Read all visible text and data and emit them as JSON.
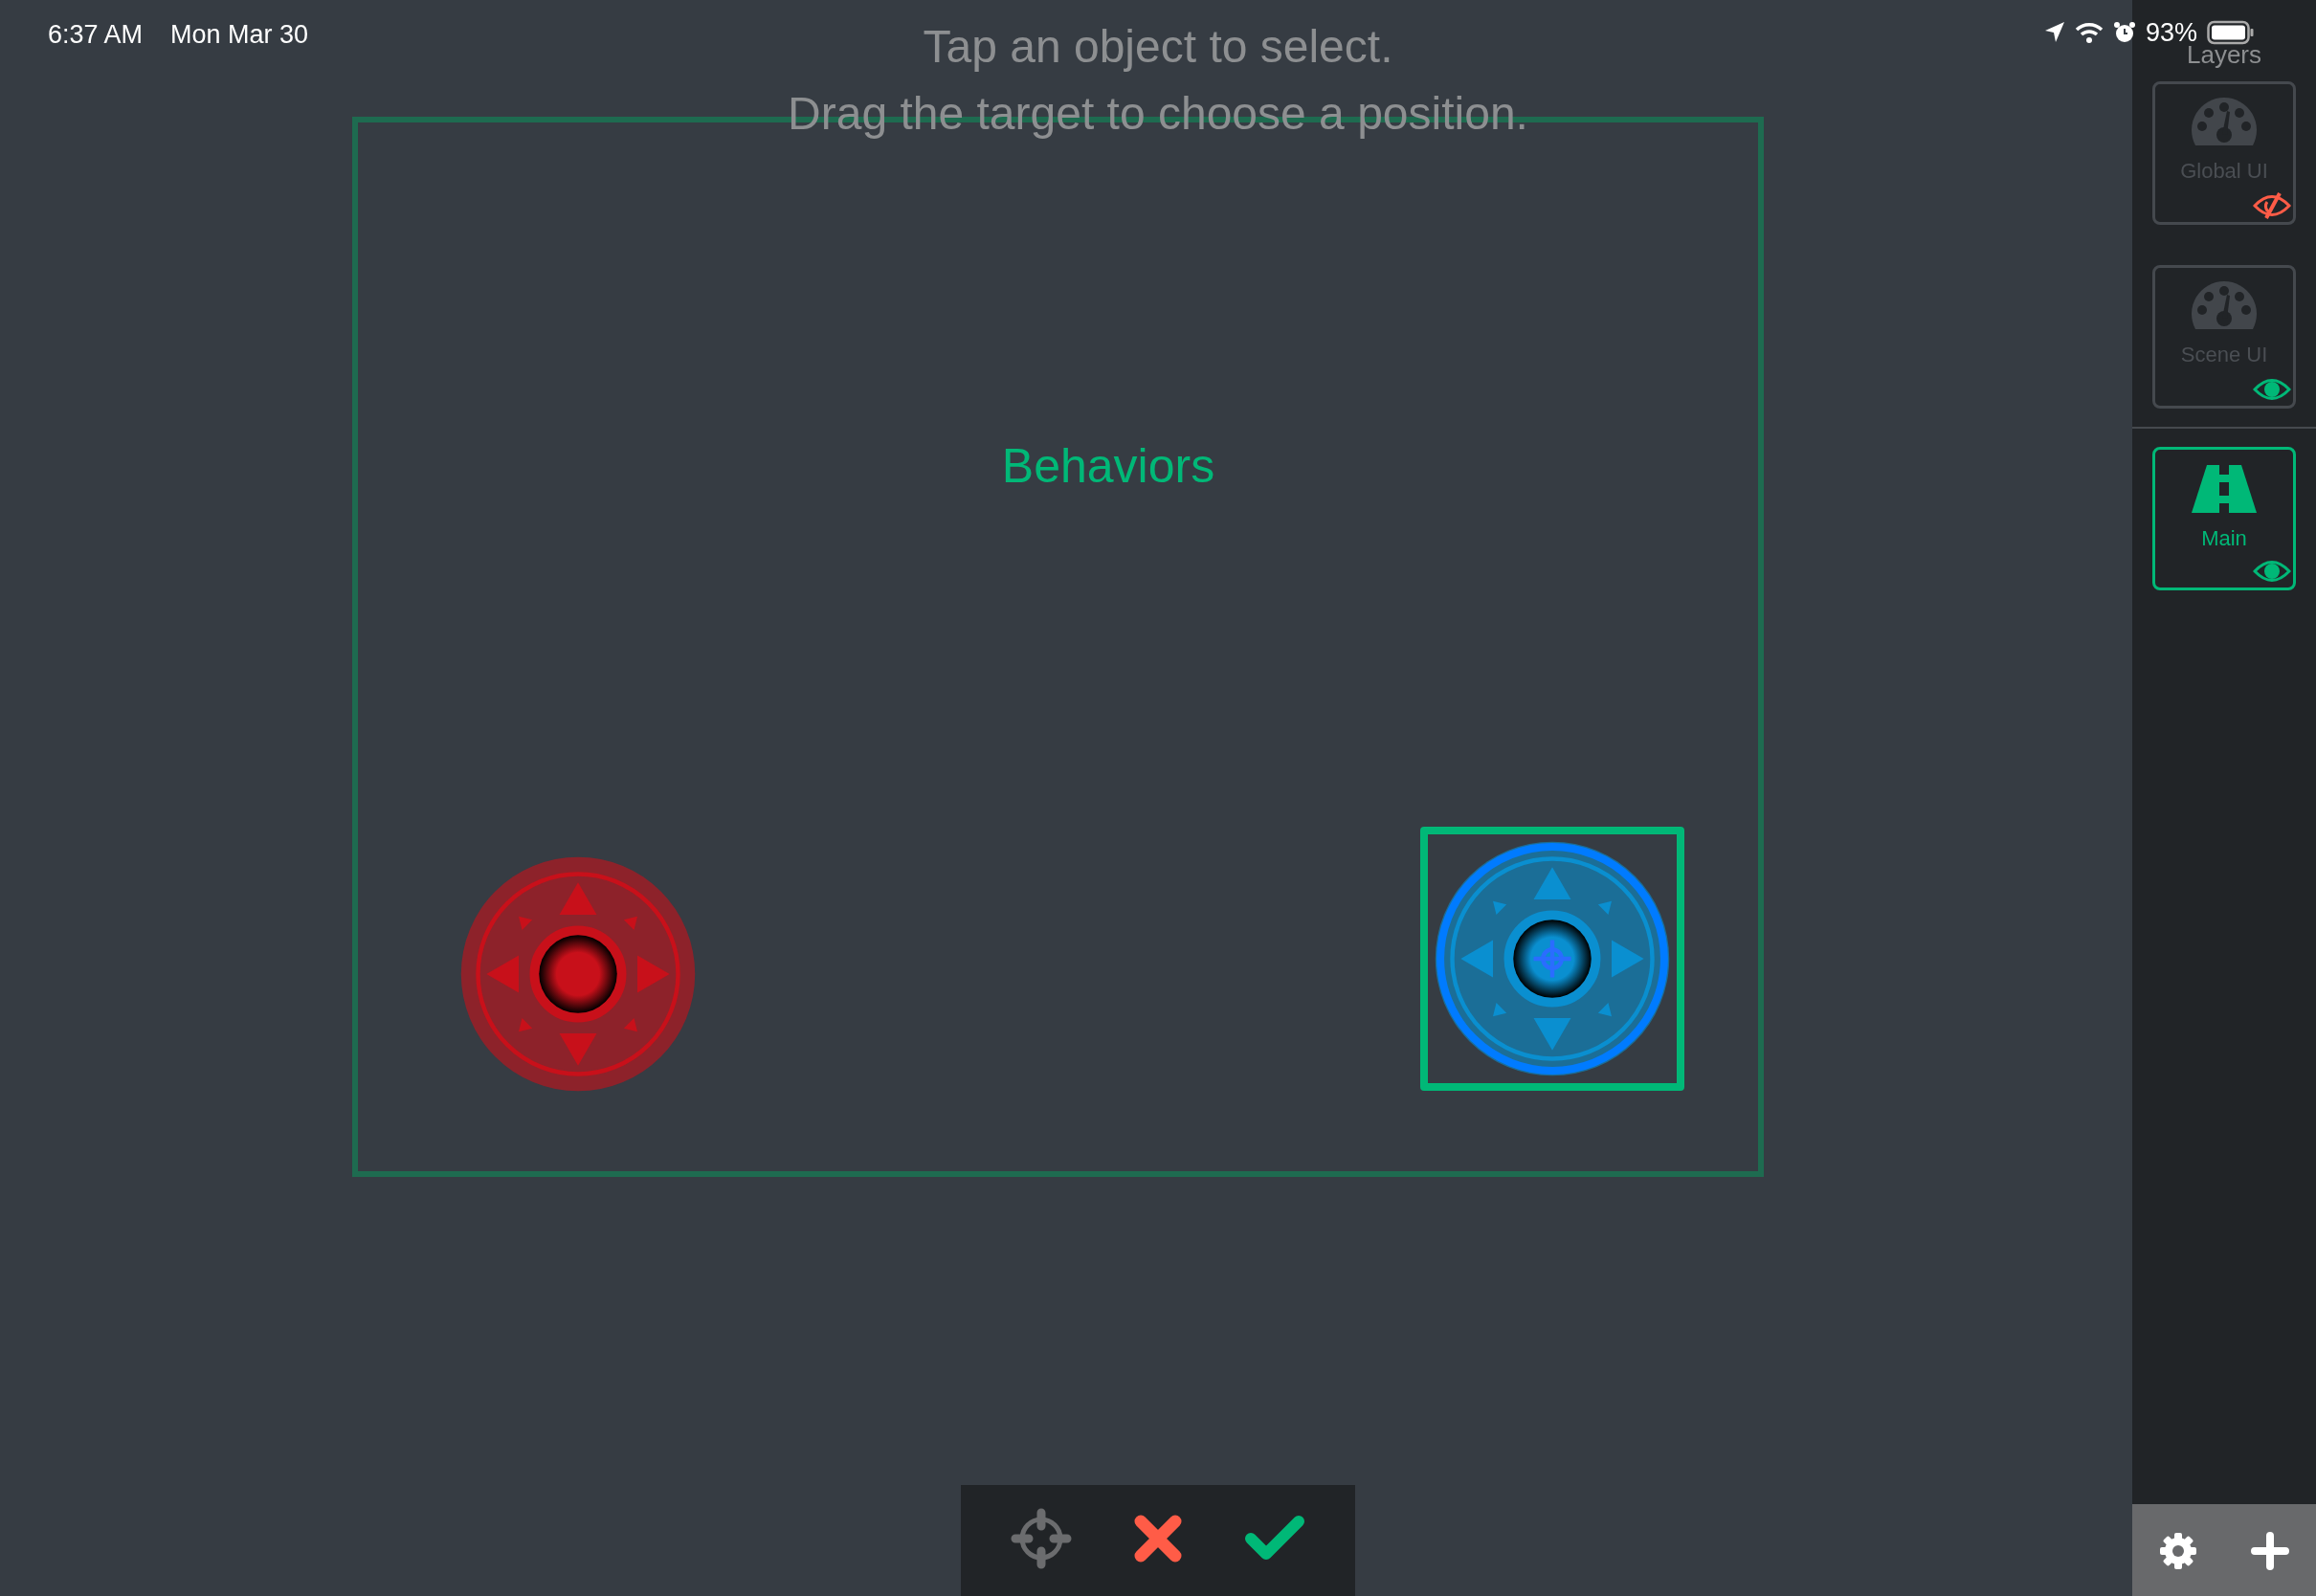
{
  "status_bar": {
    "time": "6:37 AM",
    "date": "Mon Mar 30",
    "battery": "93%"
  },
  "instructions": [
    "Tap an object to select.",
    "Drag the target to choose a position."
  ],
  "canvas": {
    "label": "Behaviors",
    "objects": [
      {
        "kind": "joystick",
        "color": "#c8101a",
        "selected": false
      },
      {
        "kind": "joystick",
        "color": "#0a8fd0",
        "selected": true
      }
    ]
  },
  "layers": {
    "title": "Layers",
    "items": [
      {
        "label": "Global UI",
        "kind": "gauge",
        "visible": false,
        "selected": false
      },
      {
        "label": "Scene UI",
        "kind": "gauge",
        "visible": true,
        "selected": false
      },
      {
        "label": "Main",
        "kind": "road",
        "visible": true,
        "selected": true
      }
    ]
  }
}
